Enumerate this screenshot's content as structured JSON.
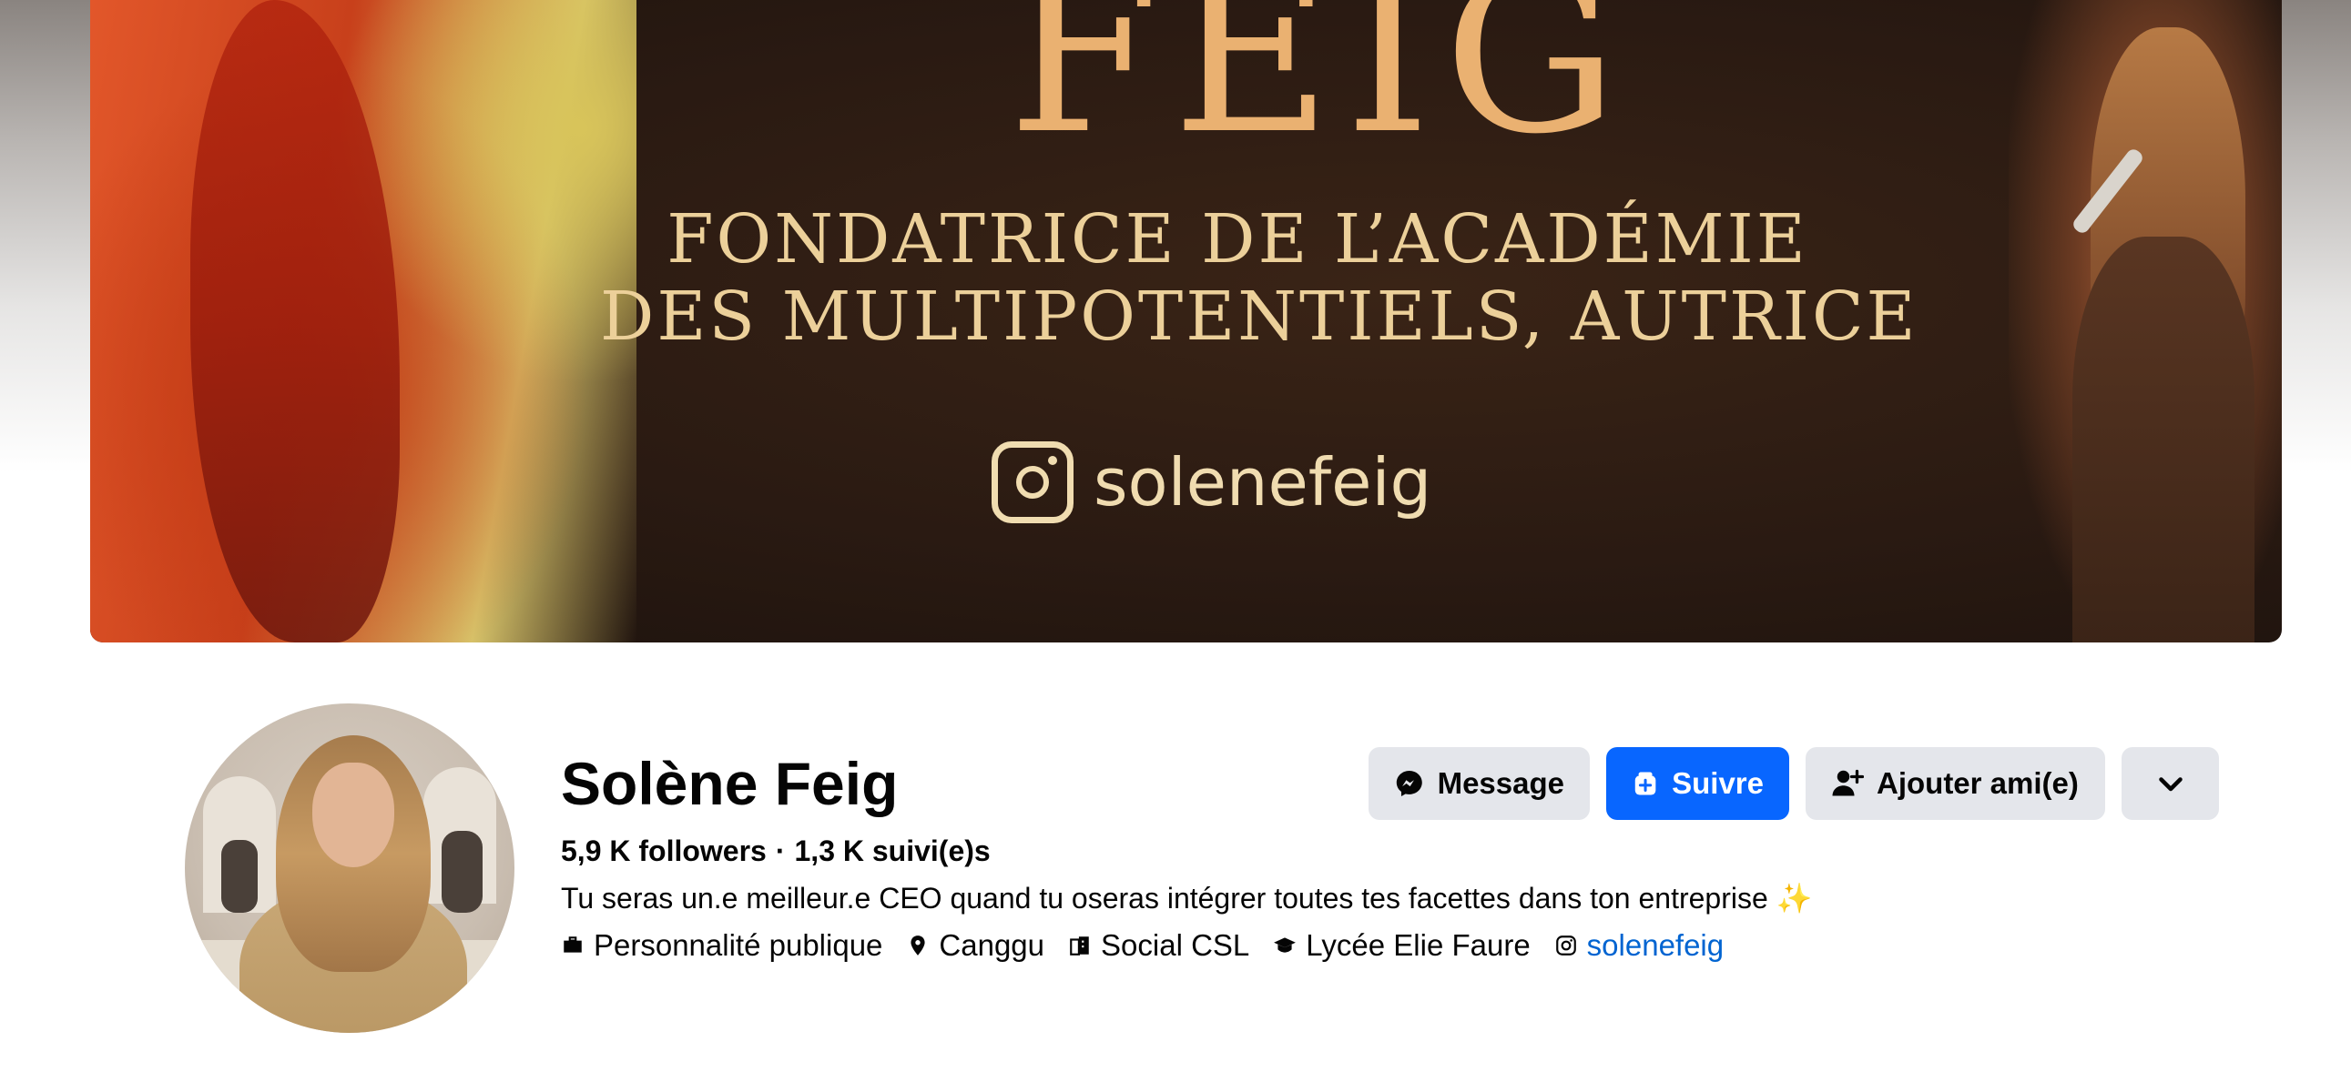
{
  "cover": {
    "big_text": "FEIG",
    "line1": "FONDATRICE DE L’ACADÉMIE",
    "line2": "DES MULTIPOTENTIELS, AUTRICE",
    "instagram_handle": "solenefeig"
  },
  "profile": {
    "name": "Solène Feig",
    "followers": "5,9 K followers",
    "separator": "·",
    "following": "1,3 K suivi(e)s",
    "bio": "Tu seras un.e meilleur.e CEO quand tu oseras intégrer toutes tes facettes dans ton entreprise",
    "bio_emoji": "✨"
  },
  "details": [
    {
      "icon": "briefcase-icon",
      "label": "Personnalité publique"
    },
    {
      "icon": "location-pin-icon",
      "label": "Canggu"
    },
    {
      "icon": "building-icon",
      "label": "Social CSL"
    },
    {
      "icon": "graduation-cap-icon",
      "label": "Lycée Elie Faure"
    },
    {
      "icon": "instagram-icon",
      "label": "solenefeig"
    }
  ],
  "actions": {
    "message_label": "Message",
    "follow_label": "Suivre",
    "add_friend_label": "Ajouter ami(e)"
  },
  "colors": {
    "primary_button": "#0866ff",
    "secondary_button": "#e4e6eb",
    "link": "#0064d1"
  }
}
